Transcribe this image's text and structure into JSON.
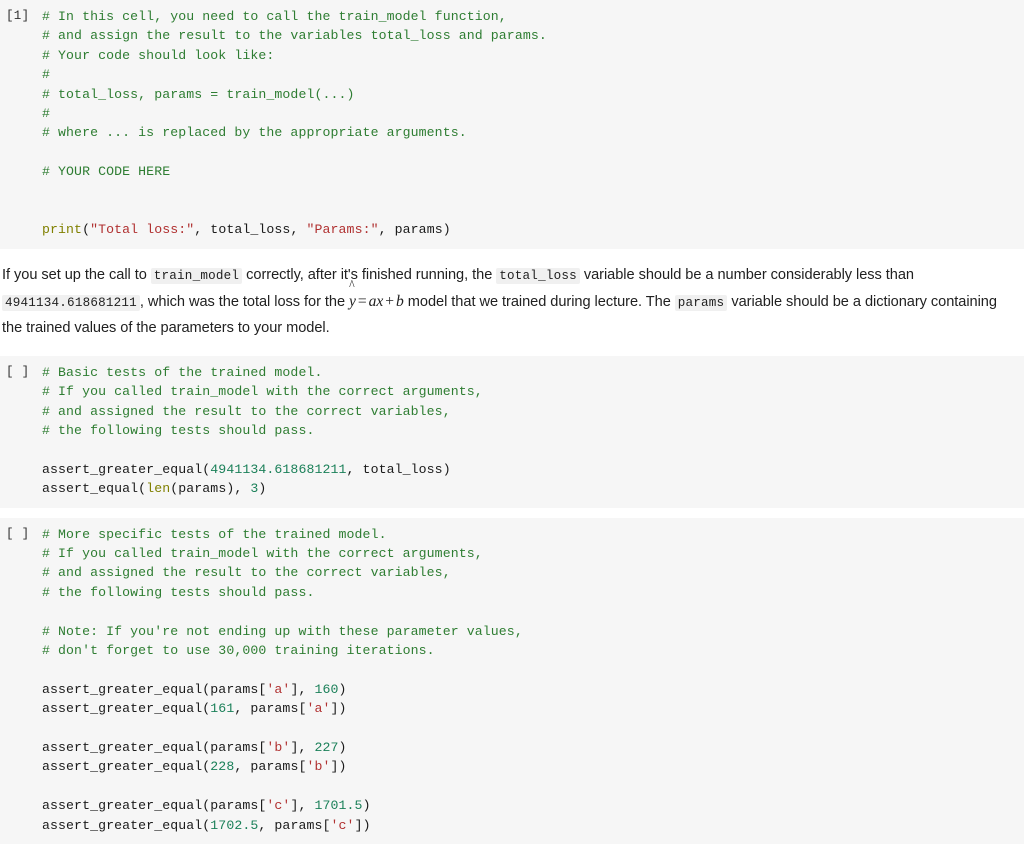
{
  "notebook": {
    "cells": [
      {
        "type": "code",
        "prompt": "[1]",
        "lines": [
          [
            {
              "t": "# In this cell, you need to call the train_model function,",
              "c": "c"
            }
          ],
          [
            {
              "t": "# and assign the result to the variables total_loss and params.",
              "c": "c"
            }
          ],
          [
            {
              "t": "# Your code should look like:",
              "c": "c"
            }
          ],
          [
            {
              "t": "#",
              "c": "c"
            }
          ],
          [
            {
              "t": "# total_loss, params = train_model(...)",
              "c": "c"
            }
          ],
          [
            {
              "t": "#",
              "c": "c"
            }
          ],
          [
            {
              "t": "# where ... is replaced by the appropriate arguments.",
              "c": "c"
            }
          ],
          [],
          [
            {
              "t": "# YOUR CODE HERE",
              "c": "c"
            }
          ],
          [],
          [],
          [
            {
              "t": "print",
              "c": "k"
            },
            {
              "t": "(",
              "c": "p"
            },
            {
              "t": "\"Total loss:\"",
              "c": "s"
            },
            {
              "t": ", total_loss, ",
              "c": "p"
            },
            {
              "t": "\"Params:\"",
              "c": "s"
            },
            {
              "t": ", params)",
              "c": "p"
            }
          ]
        ]
      },
      {
        "type": "markdown",
        "paragraph": {
          "run1": "If you set up the call to ",
          "code1": "train_model",
          "run2": " correctly, after it's finished running, the ",
          "code2": "total_loss",
          "run3": " variable should be a number considerably less than ",
          "code3": "4941134.618681211",
          "run4": ", which was the total loss for the ",
          "math": {
            "yhat": "y",
            "eq": "=",
            "a": "a",
            "x": "x",
            "plus": "+",
            "b": "b"
          },
          "run5": " model that we trained during lecture. The ",
          "code4": "params",
          "run6": " variable should be a dictionary containing the trained values of the parameters to your model."
        }
      },
      {
        "type": "code",
        "prompt": "[ ]",
        "lines": [
          [
            {
              "t": "# Basic tests of the trained model.",
              "c": "c"
            }
          ],
          [
            {
              "t": "# If you called train_model with the correct arguments,",
              "c": "c"
            }
          ],
          [
            {
              "t": "# and assigned the result to the correct variables,",
              "c": "c"
            }
          ],
          [
            {
              "t": "# the following tests should pass.",
              "c": "c"
            }
          ],
          [],
          [
            {
              "t": "assert_greater_equal(",
              "c": "p"
            },
            {
              "t": "4941134.618681211",
              "c": "n"
            },
            {
              "t": ", total_loss)",
              "c": "p"
            }
          ],
          [
            {
              "t": "assert_equal(",
              "c": "p"
            },
            {
              "t": "len",
              "c": "k"
            },
            {
              "t": "(params), ",
              "c": "p"
            },
            {
              "t": "3",
              "c": "n"
            },
            {
              "t": ")",
              "c": "p"
            }
          ]
        ]
      },
      {
        "type": "code",
        "prompt": "[ ]",
        "lines": [
          [
            {
              "t": "# More specific tests of the trained model.",
              "c": "c"
            }
          ],
          [
            {
              "t": "# If you called train_model with the correct arguments,",
              "c": "c"
            }
          ],
          [
            {
              "t": "# and assigned the result to the correct variables,",
              "c": "c"
            }
          ],
          [
            {
              "t": "# the following tests should pass.",
              "c": "c"
            }
          ],
          [],
          [
            {
              "t": "# Note: If you're not ending up with these parameter values,",
              "c": "c"
            }
          ],
          [
            {
              "t": "# don't forget to use 30,000 training iterations.",
              "c": "c"
            }
          ],
          [],
          [
            {
              "t": "assert_greater_equal(params[",
              "c": "p"
            },
            {
              "t": "'a'",
              "c": "s"
            },
            {
              "t": "], ",
              "c": "p"
            },
            {
              "t": "160",
              "c": "n"
            },
            {
              "t": ")",
              "c": "p"
            }
          ],
          [
            {
              "t": "assert_greater_equal(",
              "c": "p"
            },
            {
              "t": "161",
              "c": "n"
            },
            {
              "t": ", params[",
              "c": "p"
            },
            {
              "t": "'a'",
              "c": "s"
            },
            {
              "t": "])",
              "c": "p"
            }
          ],
          [],
          [
            {
              "t": "assert_greater_equal(params[",
              "c": "p"
            },
            {
              "t": "'b'",
              "c": "s"
            },
            {
              "t": "], ",
              "c": "p"
            },
            {
              "t": "227",
              "c": "n"
            },
            {
              "t": ")",
              "c": "p"
            }
          ],
          [
            {
              "t": "assert_greater_equal(",
              "c": "p"
            },
            {
              "t": "228",
              "c": "n"
            },
            {
              "t": ", params[",
              "c": "p"
            },
            {
              "t": "'b'",
              "c": "s"
            },
            {
              "t": "])",
              "c": "p"
            }
          ],
          [],
          [
            {
              "t": "assert_greater_equal(params[",
              "c": "p"
            },
            {
              "t": "'c'",
              "c": "s"
            },
            {
              "t": "], ",
              "c": "p"
            },
            {
              "t": "1701.5",
              "c": "n"
            },
            {
              "t": ")",
              "c": "p"
            }
          ],
          [
            {
              "t": "assert_greater_equal(",
              "c": "p"
            },
            {
              "t": "1702.5",
              "c": "n"
            },
            {
              "t": ", params[",
              "c": "p"
            },
            {
              "t": "'c'",
              "c": "s"
            },
            {
              "t": "])",
              "c": "p"
            }
          ]
        ]
      }
    ]
  }
}
